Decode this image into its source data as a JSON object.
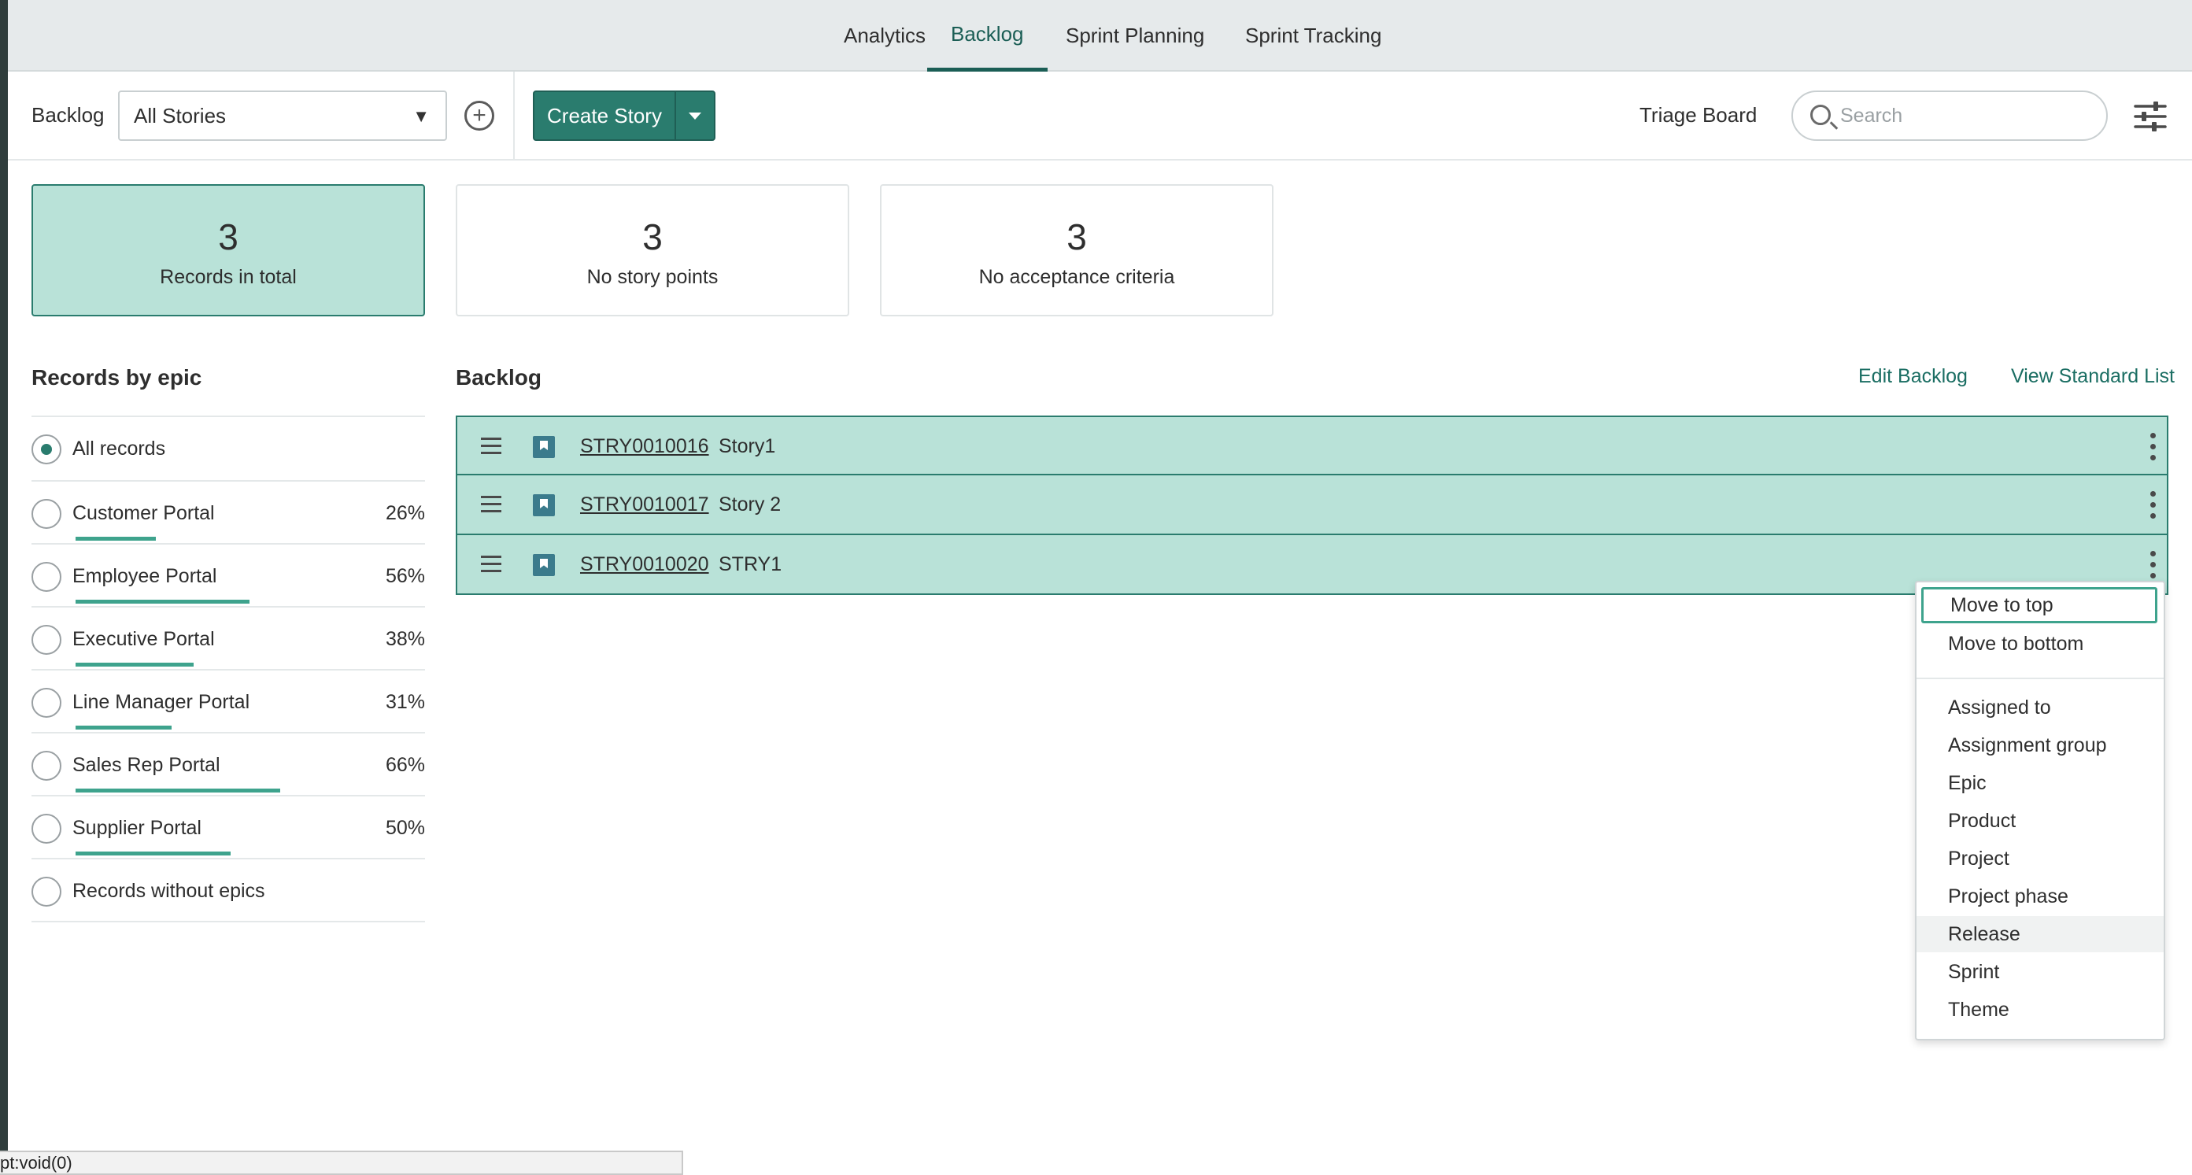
{
  "nav": {
    "tabs": [
      {
        "label": "Analytics"
      },
      {
        "label": "Backlog"
      },
      {
        "label": "Sprint Planning"
      },
      {
        "label": "Sprint Tracking"
      }
    ],
    "active_tab": "Backlog"
  },
  "toolbar": {
    "backlog_label": "Backlog",
    "filter_value": "All Stories",
    "create_label": "Create Story",
    "triage_label": "Triage Board",
    "search_placeholder": "Search"
  },
  "summary": [
    {
      "count": "3",
      "label": "Records in total"
    },
    {
      "count": "3",
      "label": "No story points"
    },
    {
      "count": "3",
      "label": "No acceptance criteria"
    }
  ],
  "epics": {
    "title": "Records by epic",
    "items": [
      {
        "name": "All records",
        "selected": true
      },
      {
        "name": "Customer Portal",
        "pct": "26%",
        "progress": 0.26
      },
      {
        "name": "Employee Portal",
        "pct": "56%",
        "progress": 0.56
      },
      {
        "name": "Executive Portal",
        "pct": "38%",
        "progress": 0.38
      },
      {
        "name": "Line Manager Portal",
        "pct": "31%",
        "progress": 0.31
      },
      {
        "name": "Sales Rep Portal",
        "pct": "66%",
        "progress": 0.66
      },
      {
        "name": "Supplier Portal",
        "pct": "50%",
        "progress": 0.5
      },
      {
        "name": "Records without epics"
      }
    ]
  },
  "backlog": {
    "title": "Backlog",
    "edit_link": "Edit Backlog",
    "view_link": "View Standard List",
    "stories": [
      {
        "number": "STRY0010016",
        "title": "Story1"
      },
      {
        "number": "STRY0010017",
        "title": "Story 2"
      },
      {
        "number": "STRY0010020",
        "title": "STRY1"
      }
    ]
  },
  "context_menu": {
    "move_items": [
      "Move to top",
      "Move to bottom"
    ],
    "field_items": [
      "Assigned to",
      "Assignment group",
      "Epic",
      "Product",
      "Project",
      "Project phase",
      "Release",
      "Sprint",
      "Theme"
    ]
  },
  "status_bar": {
    "text": "pt:void(0)"
  },
  "colors": {
    "accent": "#2a7c6e",
    "row_bg": "#b9e2d8",
    "progress": "#3ea38d",
    "nav_bg": "#e6eaeb"
  }
}
